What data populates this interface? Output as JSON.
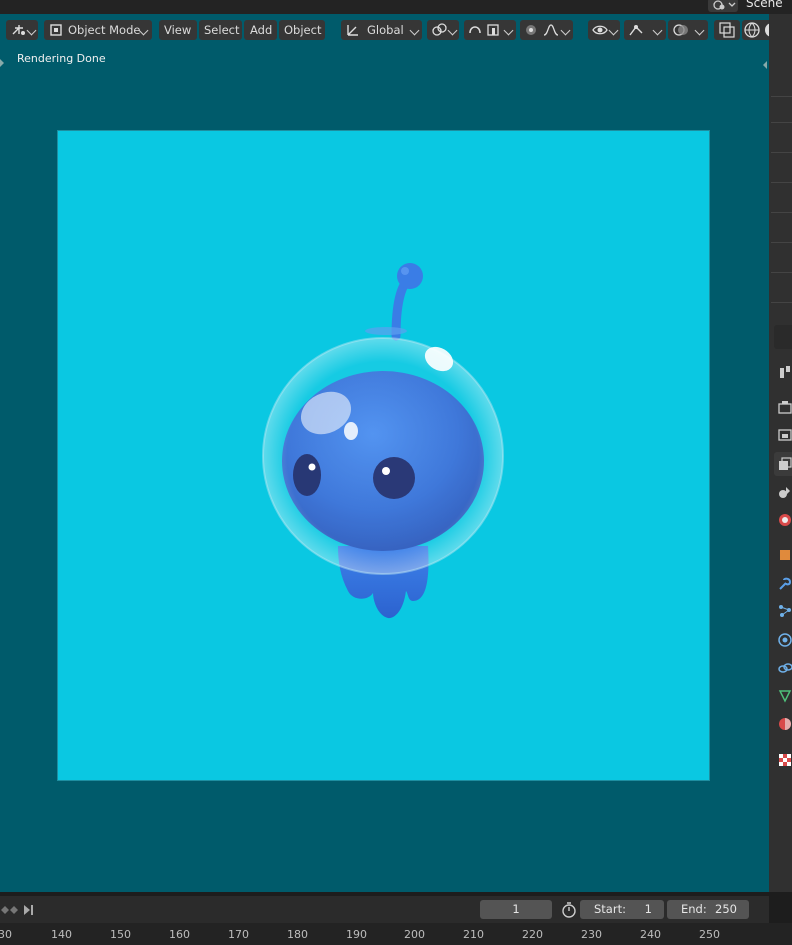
{
  "scene": {
    "label": "Scene"
  },
  "header": {
    "mode": "Object Mode",
    "menus": [
      "View",
      "Select",
      "Add",
      "Object"
    ],
    "orientation": "Global"
  },
  "status": {
    "message": "Rendering Done"
  },
  "timeline": {
    "current_frame": "1",
    "start_label": "Start:",
    "start_value": "1",
    "end_label": "End:",
    "end_value": "250",
    "ruler_ticks": [
      "30",
      "140",
      "150",
      "160",
      "170",
      "180",
      "190",
      "200",
      "210",
      "220",
      "230",
      "240",
      "250"
    ]
  },
  "colors": {
    "viewport_bg": "#005b6b",
    "render_bg": "#0ac8e2",
    "character_blue": "#3c7fe0"
  },
  "icons": [
    "editor-type-icon",
    "object-mode-icon",
    "transform-orientation-icon",
    "pivot-point-icon",
    "snap-icon",
    "snap-target-icon",
    "proportional-edit-icon",
    "falloff-curve-icon",
    "visibility-icon",
    "gizmo-icon",
    "overlay-icon",
    "xray-icon",
    "wireframe-shading-icon",
    "tool-properties-icon",
    "render-properties-icon",
    "output-properties-icon",
    "view-layer-icon",
    "scene-properties-icon",
    "world-properties-icon",
    "object-properties-icon",
    "modifier-icon",
    "particles-icon",
    "physics-icon",
    "constraints-icon",
    "object-data-icon",
    "material-icon",
    "texture-icon",
    "stopwatch-icon",
    "keyframe-jump-icon",
    "jump-end-icon"
  ]
}
